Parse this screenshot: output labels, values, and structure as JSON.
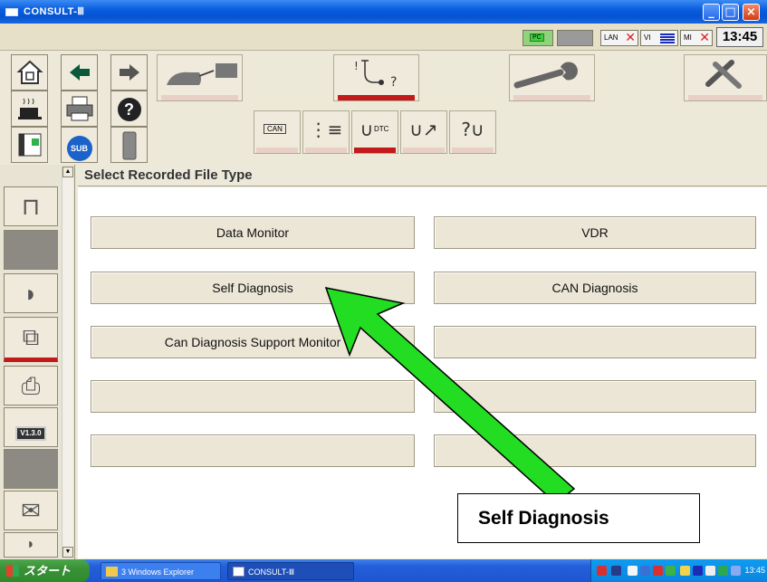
{
  "window": {
    "title": "CONSULT-Ⅲ"
  },
  "status": {
    "pc_label": "PC",
    "lan_label": "LAN",
    "vi_label": "VI",
    "mi_label": "MI",
    "time": "13:45"
  },
  "toolbar": {
    "sub_label": "SUB",
    "help_label": "?",
    "can_label": "CAN",
    "dtc_label": "DTC"
  },
  "side": {
    "version_label": "V1.3.0"
  },
  "panel": {
    "title": "Select Recorded File Type",
    "options_left": [
      "Data Monitor",
      "Self Diagnosis",
      "Can Diagnosis Support Monitor",
      "",
      ""
    ],
    "options_right": [
      "VDR",
      "CAN Diagnosis",
      "",
      "",
      ""
    ]
  },
  "callout": {
    "text": "Self Diagnosis",
    "arrow_color": "#22dd22"
  },
  "taskbar": {
    "start_label": "スタート",
    "item1": "3 Windows Explorer",
    "item2": "CONSULT-Ⅲ",
    "tray_time": "13:45"
  },
  "colors": {
    "accent_red": "#c21a1a",
    "titlebar_blue": "#0453d1",
    "panel_bg": "#ffffff"
  }
}
